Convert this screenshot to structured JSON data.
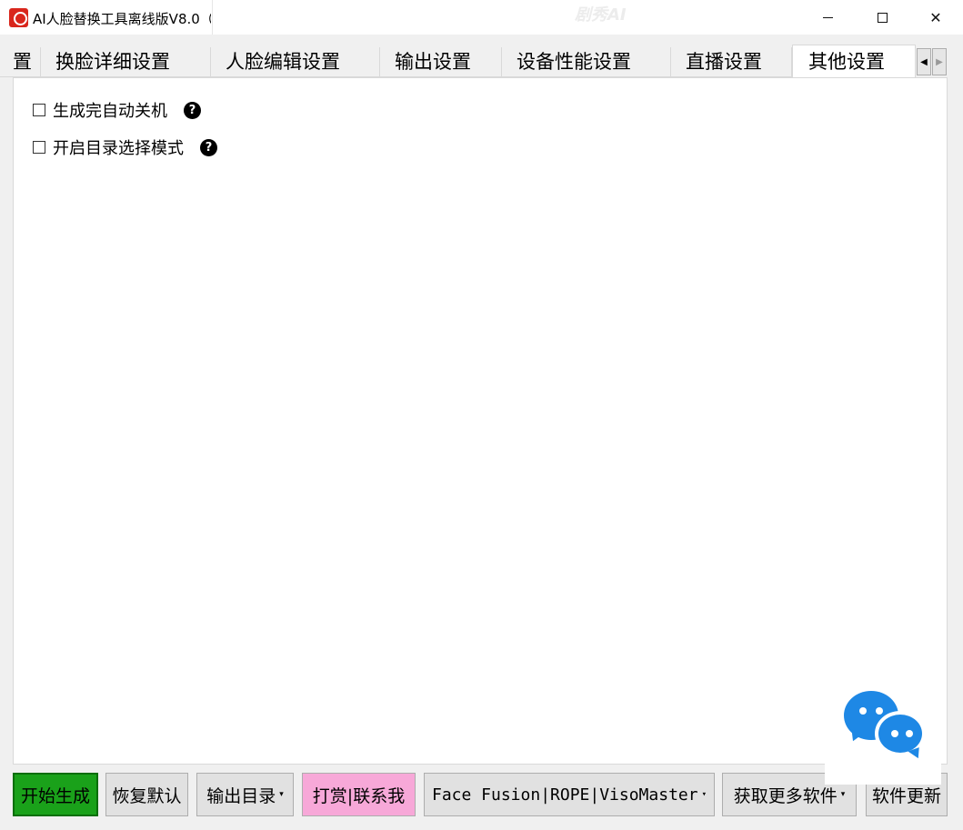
{
  "window": {
    "title": "AI人脸替换工具离线版V8.0（",
    "watermark": "剧秀AI",
    "controls": {
      "minimize": "",
      "maximize": "",
      "close": "✕"
    }
  },
  "tabs": [
    {
      "label": "置",
      "active": false
    },
    {
      "label": "换脸详细设置",
      "active": false
    },
    {
      "label": "人脸编辑设置",
      "active": false
    },
    {
      "label": "输出设置",
      "active": false
    },
    {
      "label": "设备性能设置",
      "active": false
    },
    {
      "label": "直播设置",
      "active": false
    },
    {
      "label": "其他设置",
      "active": true
    }
  ],
  "tab_scroll": {
    "left": "◀",
    "right": "▶"
  },
  "options": [
    {
      "label": "生成完自动关机",
      "checked": false,
      "help": "?"
    },
    {
      "label": "开启目录选择模式",
      "checked": false,
      "help": "?"
    }
  ],
  "buttons": {
    "start": "开始生成",
    "reset": "恢复默认",
    "output_dir": "输出目录",
    "donate": "打赏|联系我",
    "engines": "Face Fusion|ROPE|VisoMaster",
    "more": "获取更多软件",
    "update": "软件更新",
    "caret": "▾"
  },
  "colors": {
    "start_button": "#1aa11a",
    "donate_button": "#f7a8d8",
    "chat_widget": "#1e88e5",
    "app_icon": "#d9261c"
  }
}
